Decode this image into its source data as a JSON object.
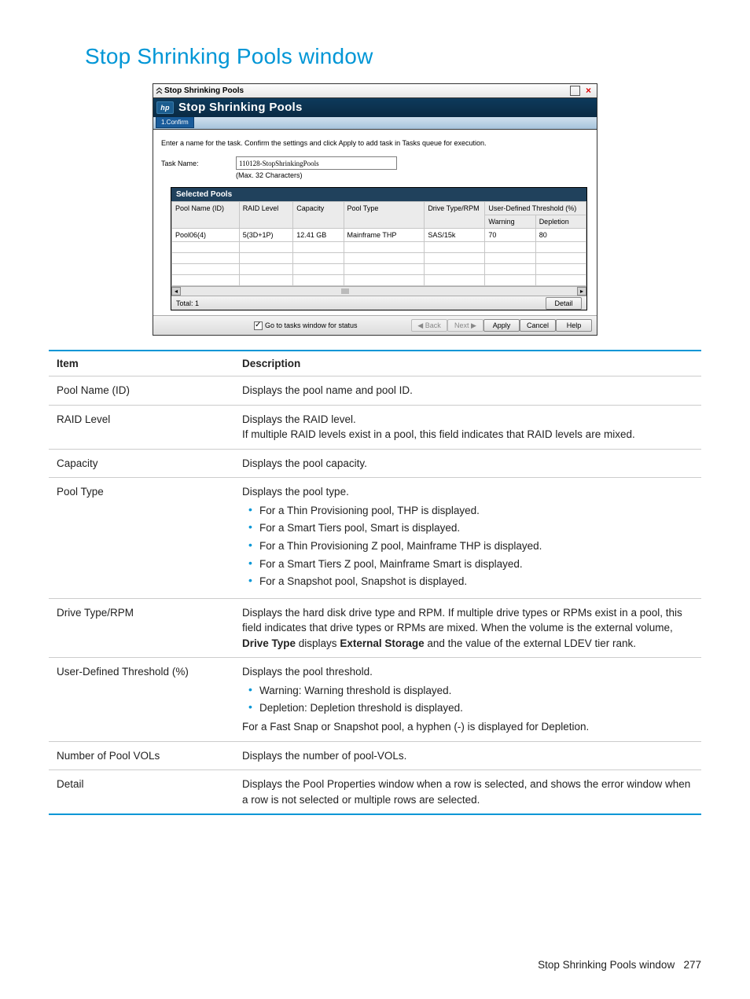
{
  "page_heading": "Stop Shrinking Pools window",
  "dialog": {
    "titlebar_text": "Stop Shrinking Pools",
    "header_text": "Stop Shrinking Pools",
    "step_tab": "1.Confirm",
    "instruction": "Enter a name for the task. Confirm the settings and click Apply to add task in Tasks queue for execution.",
    "task_name_label": "Task Name:",
    "task_name_value": "110128-StopShrinkingPools",
    "task_name_hint": "(Max. 32 Characters)",
    "grid": {
      "title": "Selected Pools",
      "cols": {
        "pool_name": "Pool Name (ID)",
        "raid": "RAID Level",
        "capacity": "Capacity",
        "pool_type": "Pool Type",
        "drive": "Drive Type/RPM",
        "udt_group": "User-Defined Threshold (%)",
        "warning": "Warning",
        "depletion": "Depletion"
      },
      "row": {
        "pool_name": "Pool06(4)",
        "raid": "5(3D+1P)",
        "capacity": "12.41 GB",
        "pool_type": "Mainframe THP",
        "drive": "SAS/15k",
        "warning": "70",
        "depletion": "80"
      },
      "total_label": "Total:  1",
      "detail_btn": "Detail"
    },
    "footer": {
      "checkbox_label": "Go to tasks window for status",
      "back": "Back",
      "next": "Next",
      "apply": "Apply",
      "cancel": "Cancel",
      "help": "Help"
    }
  },
  "desc_headers": {
    "item": "Item",
    "description": "Description"
  },
  "desc_rows": {
    "r1": {
      "item": "Pool Name (ID)",
      "desc": "Displays the pool name and pool ID."
    },
    "r2": {
      "item": "RAID Level",
      "line1": "Displays the RAID level.",
      "line2": "If multiple RAID levels exist in a pool, this field indicates that RAID levels are mixed."
    },
    "r3": {
      "item": "Capacity",
      "desc": "Displays the pool capacity."
    },
    "r4": {
      "item": "Pool Type",
      "line1": "Displays the pool type.",
      "b1": "For a Thin Provisioning pool, THP is displayed.",
      "b2": "For a Smart Tiers pool, Smart is displayed.",
      "b3": "For a Thin Provisioning Z pool, Mainframe THP is displayed.",
      "b4": "For a Smart Tiers Z pool, Mainframe Smart is displayed.",
      "b5": "For a Snapshot pool, Snapshot is displayed."
    },
    "r5": {
      "item": "Drive Type/RPM",
      "pre": "Displays the hard disk drive type and RPM. If multiple drive types or RPMs exist in a pool, this field indicates that drive types or RPMs are mixed. When the volume is the external volume, ",
      "b1": "Drive Type",
      "mid": " displays ",
      "b2": "External Storage",
      "post": " and the value of the external LDEV tier rank."
    },
    "r6": {
      "item": "User-Defined Threshold (%)",
      "line1": "Displays the pool threshold.",
      "b1": "Warning: Warning threshold is displayed.",
      "b2": "Depletion: Depletion threshold is displayed.",
      "line2": "For a Fast Snap or Snapshot pool, a hyphen (-) is displayed for Depletion."
    },
    "r7": {
      "item": "Number of Pool VOLs",
      "desc": "Displays the number of pool-VOLs."
    },
    "r8": {
      "item": "Detail",
      "desc": "Displays the Pool Properties window when a row is selected, and shows the error window when a row is not selected or multiple rows are selected."
    }
  },
  "footer_text": "Stop Shrinking Pools window",
  "footer_page": "277"
}
